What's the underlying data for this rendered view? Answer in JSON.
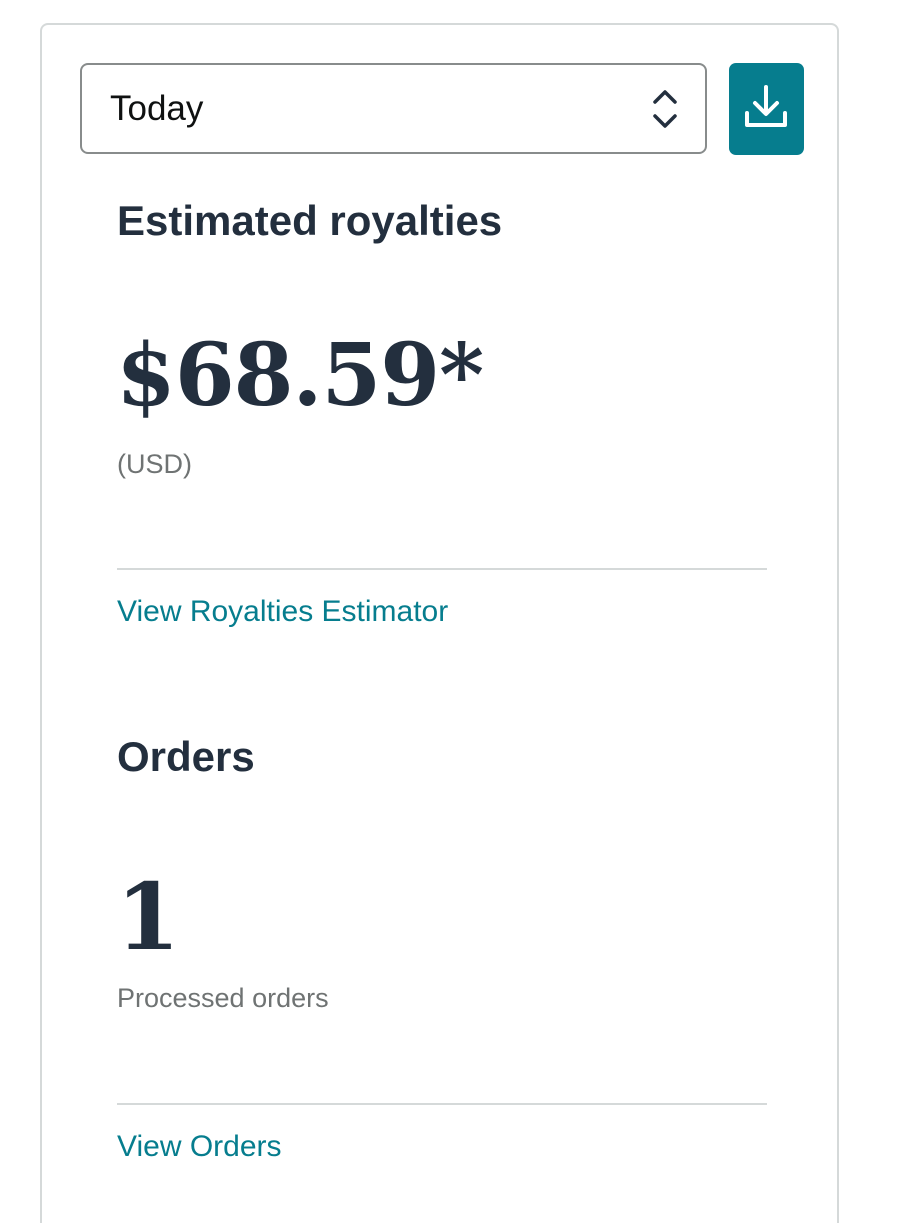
{
  "period_select": {
    "value": "Today"
  },
  "download": {
    "icon": "download-icon",
    "color": "#067d8e"
  },
  "royalties": {
    "title": "Estimated royalties",
    "amount": "$68.59*",
    "currency": "(USD)",
    "link_label": "View Royalties Estimator"
  },
  "orders": {
    "title": "Orders",
    "count": "1",
    "caption": "Processed orders",
    "link_label": "View Orders"
  },
  "colors": {
    "accent": "#067d8e",
    "heading": "#232f3e",
    "muted": "#6f7373"
  }
}
